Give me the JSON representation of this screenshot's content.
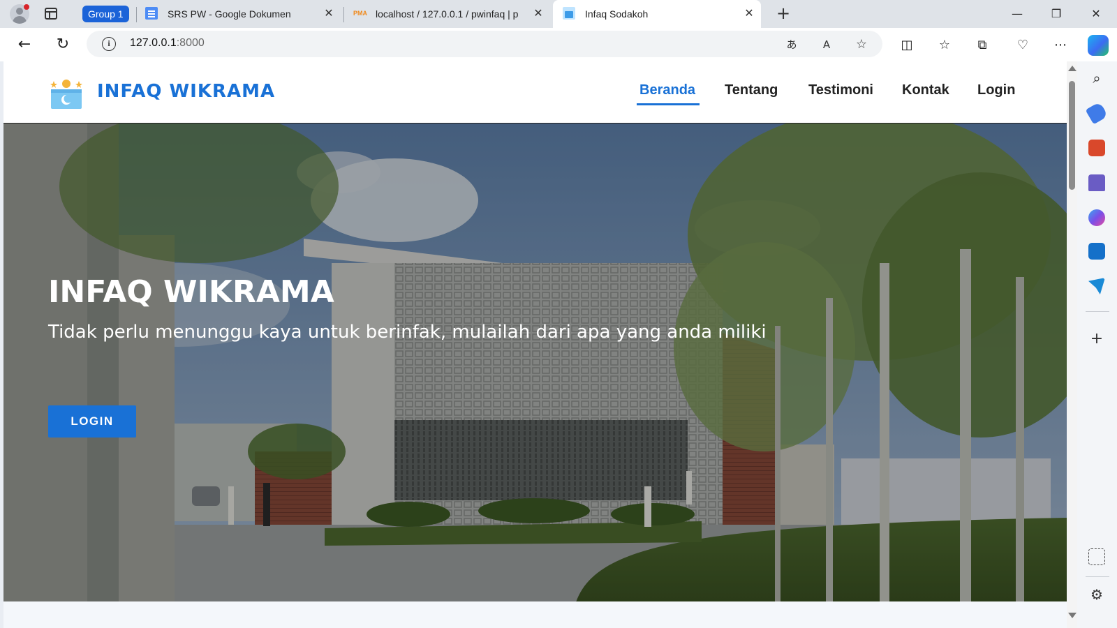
{
  "browser": {
    "tab_group": "Group 1",
    "tabs": [
      {
        "title": "SRS PW - Google Dokumen",
        "icon": "google-docs-icon",
        "active": false
      },
      {
        "title": "localhost / 127.0.0.1 / pwinfaq | p",
        "icon": "phpmyadmin-icon",
        "active": false
      },
      {
        "title": "Infaq Sodakoh",
        "icon": "infaq-favicon-icon",
        "active": true
      }
    ],
    "url_host": "127.0.0.1",
    "url_port": ":8000",
    "pma_icon_text": "PMA",
    "colors": {
      "accent": "#1b63d8",
      "tabstrip": "#dfe3e8"
    }
  },
  "site": {
    "brand": "INFAQ WIKRAMA",
    "nav": [
      {
        "label": "Beranda",
        "active": true
      },
      {
        "label": "Tentang",
        "active": false
      },
      {
        "label": "Testimoni",
        "active": false
      },
      {
        "label": "Kontak",
        "active": false
      },
      {
        "label": "Login",
        "active": false
      }
    ],
    "hero": {
      "title": "INFAQ WIKRAMA",
      "subtitle": "Tidak perlu menunggu kaya untuk berinfak, mulailah dari apa yang anda miliki",
      "button": "LOGIN"
    },
    "colors": {
      "primary": "#1971d6"
    }
  }
}
